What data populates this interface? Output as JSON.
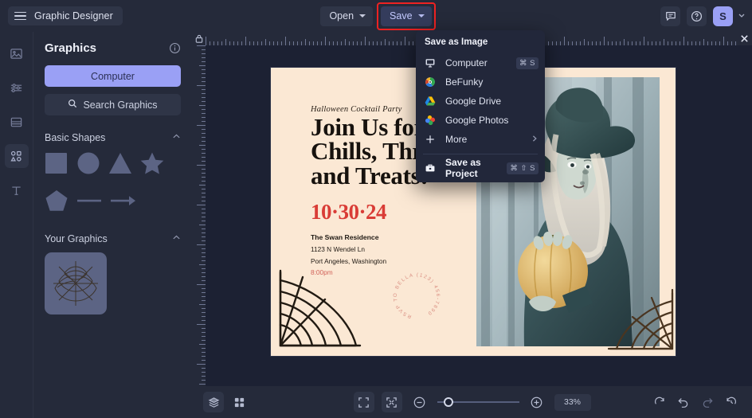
{
  "app": {
    "name": "Graphic Designer",
    "accent": "#9aa0f5",
    "highlight_color": "#ee2222",
    "panel_bg": "#252a3a",
    "workspace_bg": "#1c2133"
  },
  "topbar": {
    "menu_icon": "hamburger-icon",
    "open_label": "Open",
    "save_label": "Save",
    "icons": [
      "feedback-icon",
      "help-icon"
    ],
    "avatar_initial": "S"
  },
  "rail": {
    "items": [
      {
        "name": "photo",
        "icon": "image-icon",
        "active": false
      },
      {
        "name": "edit",
        "icon": "sliders-icon",
        "active": false
      },
      {
        "name": "templates",
        "icon": "template-icon",
        "active": false
      },
      {
        "name": "graphics",
        "icon": "shapes-icon",
        "active": true
      },
      {
        "name": "text",
        "icon": "text-icon",
        "active": false
      }
    ]
  },
  "panel": {
    "title": "Graphics",
    "info_icon": "info-icon",
    "computer_label": "Computer",
    "search_label": "Search Graphics",
    "search_icon": "search-icon",
    "sections": [
      {
        "title": "Basic Shapes",
        "collapse_icon": "chevron-up-icon"
      },
      {
        "title": "Your Graphics",
        "collapse_icon": "chevron-up-icon"
      }
    ],
    "shapes_row1": [
      "square",
      "circle",
      "triangle",
      "star"
    ],
    "shapes_row2": [
      "pentagon",
      "line",
      "arrow"
    ],
    "shape_color": "#5c6484",
    "your_graphics": [
      {
        "name": "spiderweb-graphic"
      }
    ]
  },
  "save_menu": {
    "title": "Save as Image",
    "items": [
      {
        "label": "Computer",
        "icon": "monitor-icon",
        "shortcut": "⌘ S",
        "strong": false,
        "arrow": false
      },
      {
        "label": "BeFunky",
        "icon": "befunky-logo-icon",
        "shortcut": "",
        "strong": false,
        "arrow": false
      },
      {
        "label": "Google Drive",
        "icon": "google-drive-icon",
        "shortcut": "",
        "strong": false,
        "arrow": false
      },
      {
        "label": "Google Photos",
        "icon": "google-photos-icon",
        "shortcut": "",
        "strong": false,
        "arrow": false
      },
      {
        "label": "More",
        "icon": "plus-icon",
        "shortcut": "",
        "strong": false,
        "arrow": true
      }
    ],
    "project_item": {
      "label": "Save as Project",
      "icon": "briefcase-icon",
      "shortcut": "⌘ ⇧ S",
      "strong": true
    }
  },
  "ruler": {
    "lock_icon": "lock-icon",
    "close_icon": "close-icon"
  },
  "design": {
    "background": "#fbe8d4",
    "eyebrow": "Halloween Cocktail Party",
    "headline": "Join Us for Chills, Thrills and Treats!",
    "date": "10·30·24",
    "date_color": "#d93c36",
    "venue": "The Swan Residence",
    "address_line1": "1123 N Wendel Ln",
    "address_line2": "Port Angeles, Washington",
    "time": "8:00pm",
    "seal_text": "RSVP TO BELLA (123) 456-7890",
    "decorations": [
      "spiderweb-bottom-left",
      "spiderweb-bottom-right"
    ],
    "photo_alt": "witch-holding-pumpkin-photo"
  },
  "bottombar": {
    "layers_icon": "layers-icon",
    "grid_icon": "grid-icon",
    "fullscreen_icon": "expand-icon",
    "fit_icon": "fit-to-screen-icon",
    "zoom_out_icon": "zoom-out-icon",
    "zoom_in_icon": "zoom-in-icon",
    "zoom_value": "33%",
    "zoom_percent": 33,
    "rotate_icon": "rotate-icon",
    "undo_icon": "undo-icon",
    "redo_icon": "redo-icon",
    "history_icon": "history-icon"
  }
}
